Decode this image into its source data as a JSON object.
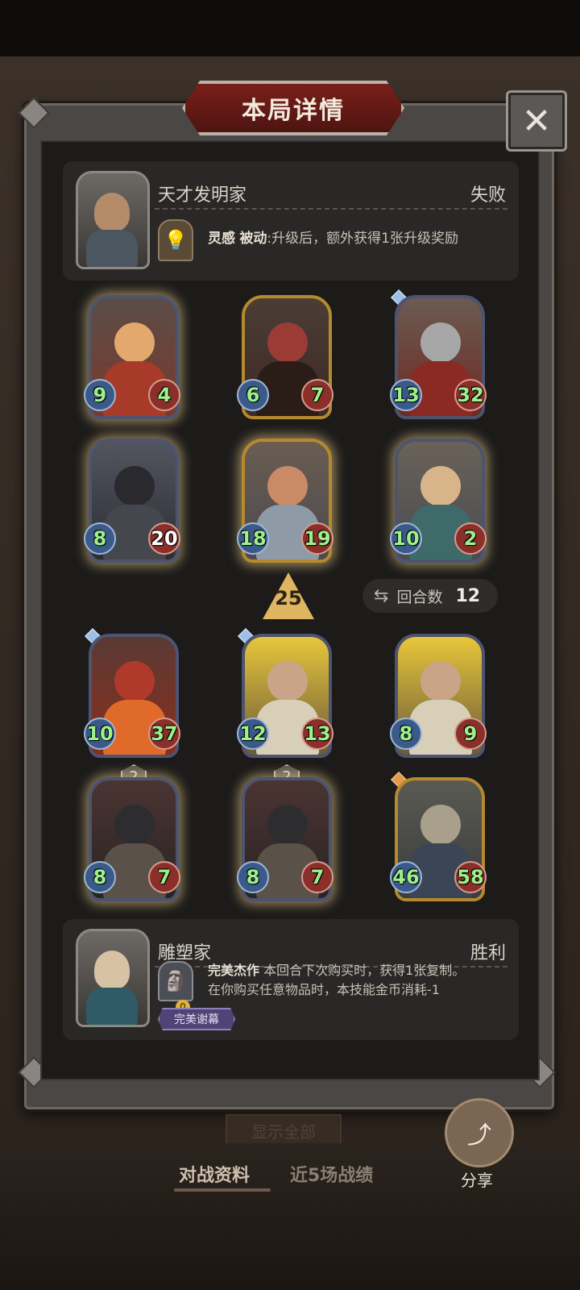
{
  "header": {
    "title": "本局详情",
    "close_icon": "close-icon"
  },
  "player1": {
    "name": "天才发明家",
    "result": "失败",
    "skill": {
      "name": "灵感",
      "type": "被动",
      "desc": ":升级后，额外获得1张升级奖励"
    }
  },
  "player1_cards": [
    {
      "atk": "9",
      "hp": "4"
    },
    {
      "atk": "6",
      "hp": "7"
    },
    {
      "atk": "13",
      "hp": "32"
    },
    {
      "atk": "8",
      "hp": "20"
    },
    {
      "atk": "18",
      "hp": "19"
    },
    {
      "atk": "10",
      "hp": "2"
    }
  ],
  "level_up": "25",
  "rounds": {
    "label": "回合数",
    "value": "12"
  },
  "player2_cards": [
    {
      "atk": "10",
      "hp": "37"
    },
    {
      "atk": "12",
      "hp": "13"
    },
    {
      "atk": "8",
      "hp": "9"
    },
    {
      "atk": "8",
      "hp": "7",
      "level": "2"
    },
    {
      "atk": "8",
      "hp": "7",
      "level": "2"
    },
    {
      "atk": "46",
      "hp": "58"
    }
  ],
  "player2": {
    "name": "雕塑家",
    "result": "胜利",
    "skill": {
      "name": "完美杰作",
      "desc1": "本回合下次购买时，获得1张复制。",
      "desc2": "在你购买任意物品时，本技能金币消耗-1",
      "coin": "0"
    },
    "badge": "完美谢幕"
  },
  "bottom": {
    "hide_all": "显示全部",
    "tab_active": "对战资料",
    "tab_inactive": "近5场战绩",
    "share_label": "分享"
  }
}
